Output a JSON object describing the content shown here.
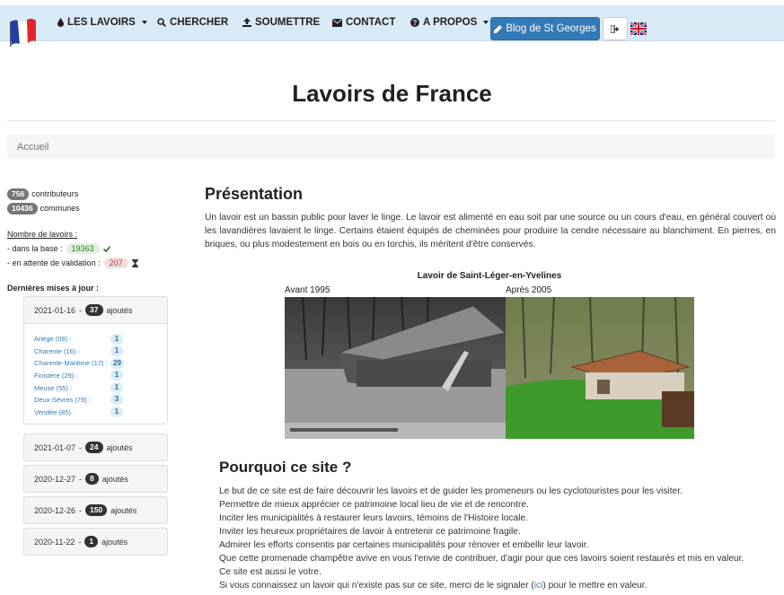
{
  "nav": {
    "lavoirs": "LES LAVOIRS",
    "chercher": "CHERCHER",
    "soumettre": "SOUMETTRE",
    "contact": "CONTACT",
    "apropos": "A PROPOS",
    "blog": "Blog de St Georges"
  },
  "header": {
    "title": "Lavoirs de France"
  },
  "breadcrumb": {
    "home": "Accueil"
  },
  "sidebar": {
    "contributeurs_count": "756",
    "contributeurs_label": "contributeurs",
    "communes_count": "10436",
    "communes_label": "communes",
    "lavoirs_title": "Nombre de lavoirs :",
    "in_base_label": "- dans la base :",
    "in_base_count": "19363",
    "pending_label": "- en attente de validation :",
    "pending_count": "207",
    "updates_title": "Dernières mises à jour :",
    "updates": [
      {
        "date": "2021-01-16",
        "count": "37",
        "label": "ajoutés",
        "expanded": true,
        "details": [
          {
            "dept": "Ariège (09) :",
            "count": "1"
          },
          {
            "dept": "Charente (16) :",
            "count": "1"
          },
          {
            "dept": "Charente-Maritime (17) :",
            "count": "29"
          },
          {
            "dept": "Finistère (29) :",
            "count": "1"
          },
          {
            "dept": "Meuse (55) :",
            "count": "1"
          },
          {
            "dept": "Deux-Sèvres (79) :",
            "count": "3"
          },
          {
            "dept": "Vendée (85) :",
            "count": "1"
          }
        ]
      },
      {
        "date": "2021-01-07",
        "count": "24",
        "label": "ajoutés"
      },
      {
        "date": "2020-12-27",
        "count": "8",
        "label": "ajoutés"
      },
      {
        "date": "2020-12-26",
        "count": "150",
        "label": "ajoutés"
      },
      {
        "date": "2020-11-22",
        "count": "1",
        "label": "ajoutés"
      }
    ]
  },
  "main": {
    "presentation_title": "Présentation",
    "presentation_text": "Un lavoir est un bassin public pour laver le linge. Le lavoir est alimenté en eau soit par une source ou un cours d'eau, en général couvert où les lavandières lavaient le linge. Certains étaient équipés de cheminées pour produire la cendre nécessaire au blanchiment. En pierres, en briques, ou plus modestement en bois ou en torchis, ils méritent d'être conservés.",
    "figure_title": "Lavoir de Saint-Léger-en-Yvelines",
    "figure_before": "Avant 1995",
    "figure_after": "Après 2005",
    "pourquoi_title": "Pourquoi ce site ?",
    "pourquoi_lines": [
      "Le but de ce site est de faire découvrir les lavoirs et de guider les promeneurs ou les cyclotouristes pour les visiter.",
      "Permettre de mieux apprécier ce patrimoine local lieu de vie et de rencontre.",
      "Inciter les municipalités à restaurer leurs lavoirs, témoins de l'Histoire locale.",
      "Inviter les heureux propriétaires de lavoir à entretenir ce patrimoine fragile.",
      "Admirer les efforts consentis par certaines municipalités pour rénover et embellir leur lavoir.",
      "Que cette promenade champêtre avive en vous l'envie de contribuer, d'agir pour que ces lavoirs soient restaurés et mis en valeur.",
      "Ce site est aussi le votre."
    ],
    "signal_before": "Si vous connaissez un lavoir qui n'existe pas sur ce site, merci de le signaler (",
    "signal_link": "ici",
    "signal_after": ") pour le mettre en valeur."
  },
  "icons": [
    "french-flag-logo-icon",
    "droplet-icon",
    "search-icon",
    "upload-icon",
    "envelope-icon",
    "question-circle-icon",
    "pencil-icon",
    "logout-icon",
    "uk-flag-icon",
    "check-icon",
    "hourglass-icon"
  ],
  "colors": {
    "navbar_bg": "#d9eaf7",
    "primary": "#337ab7",
    "green_badge": "#dff0d8",
    "red_badge": "#f2dede"
  }
}
